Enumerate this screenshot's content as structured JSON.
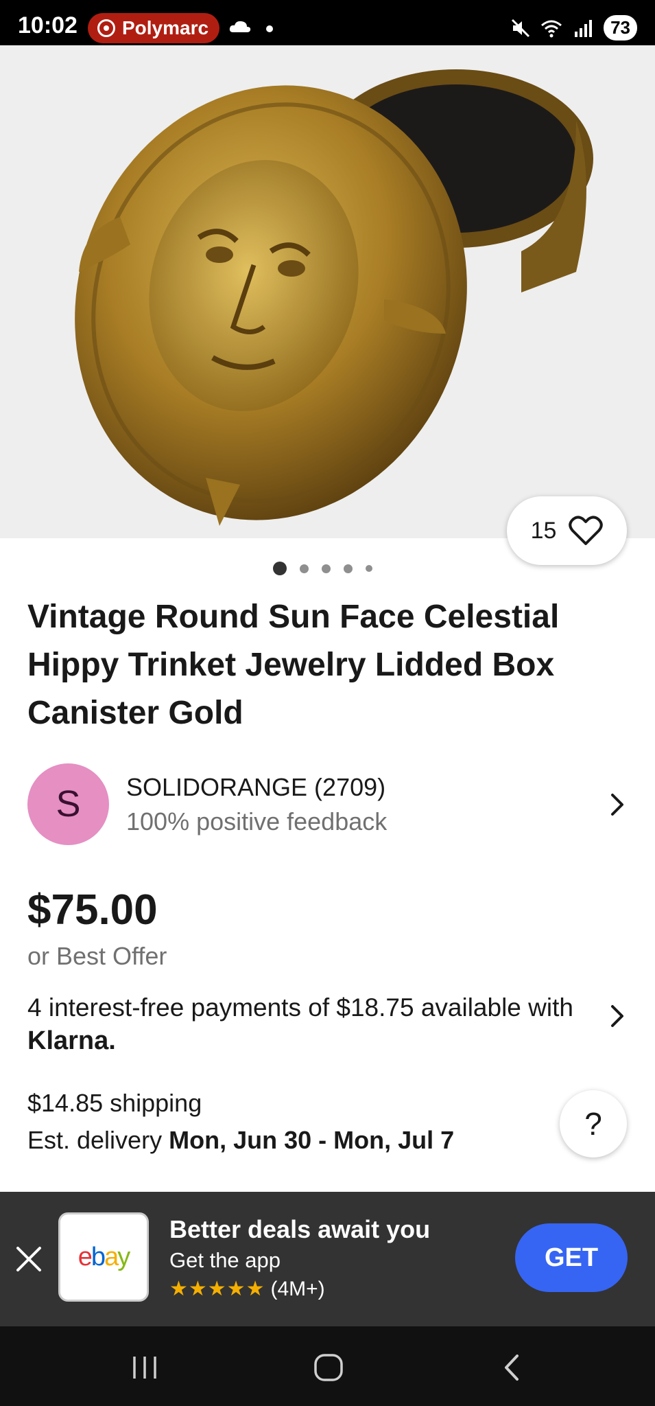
{
  "status_bar": {
    "time": "10:02",
    "notification_app": "Polymarc",
    "battery": "73"
  },
  "listing": {
    "watch_count": "15",
    "title": "Vintage Round Sun Face Celestial Hippy Trinket Jewelry Lidded Box Canister Gold",
    "image_dots": 5,
    "active_image": 1
  },
  "seller": {
    "initial": "S",
    "name": "SOLIDORANGE (2709)",
    "feedback": "100% positive feedback"
  },
  "price": {
    "amount": "$75.00",
    "best_offer": "or Best Offer"
  },
  "installments": {
    "text": "4 interest-free payments of $18.75 available with",
    "provider": "Klarna."
  },
  "shipping": {
    "cost": "$14.85 shipping",
    "delivery_label": "Est. delivery",
    "delivery_dates": "Mon, Jun 30 - Mon, Jul 7"
  },
  "help": {
    "label": "?"
  },
  "app_banner": {
    "title": "Better deals await you",
    "subtitle": "Get the app",
    "rating_count": "(4M+)",
    "cta": "GET",
    "logo": "ebay"
  },
  "colors": {
    "accent": "#3665f3",
    "banner_bg": "#333333",
    "avatar_bg": "#e58fc3",
    "star": "#f5af02"
  }
}
